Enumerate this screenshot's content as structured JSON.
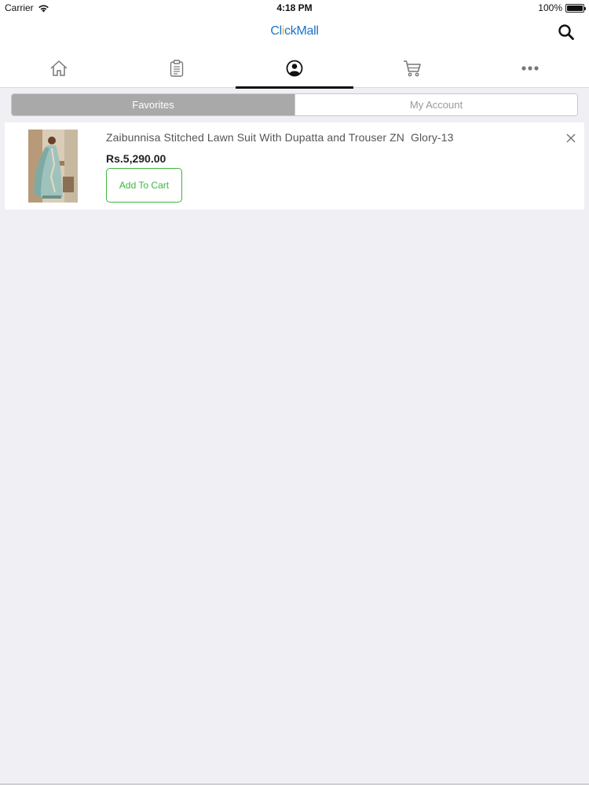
{
  "status_bar": {
    "carrier": "Carrier",
    "time": "4:18 PM",
    "battery_text": "100%",
    "battery_level_percent": 100
  },
  "header": {
    "logo_part1": "Cl",
    "logo_dot": "i",
    "logo_part2": "ckMall",
    "search_icon": "search-icon",
    "brand_color": "#1a73c9",
    "accent_color": "#f5b800"
  },
  "tabs": [
    {
      "name": "home",
      "icon": "home-icon",
      "active": false
    },
    {
      "name": "orders",
      "icon": "clipboard-icon",
      "active": false
    },
    {
      "name": "account",
      "icon": "user-circle-icon",
      "active": true
    },
    {
      "name": "cart",
      "icon": "cart-icon",
      "active": false
    },
    {
      "name": "more",
      "icon": "more-dots-icon",
      "active": false
    }
  ],
  "segmented": {
    "favorites_label": "Favorites",
    "account_label": "My Account",
    "selected": "Favorites"
  },
  "favorites": [
    {
      "title": "Zaibunnisa Stitched Lawn Suit With Dupatta and Trouser ZN  Glory-13",
      "price": "Rs.5,290.00",
      "add_to_cart_label": "Add To Cart",
      "remove_icon": "close-icon",
      "add_button_color": "#3db53d"
    }
  ]
}
